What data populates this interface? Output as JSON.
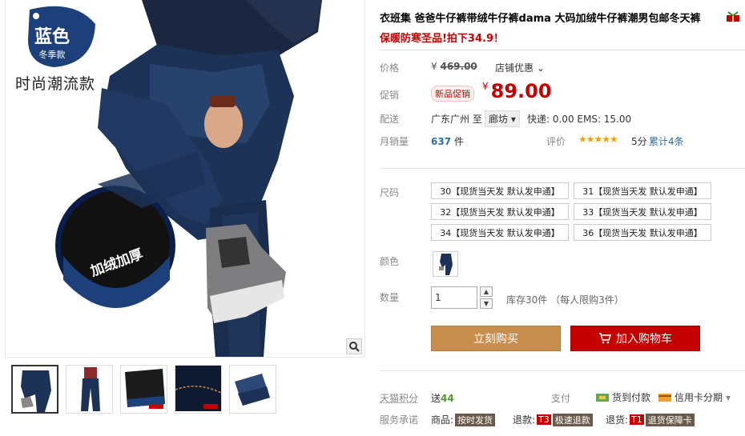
{
  "gallery": {
    "badge_main": "蓝色",
    "badge_sub": "冬季款",
    "slogan": "时尚潮流款",
    "lens_label": "加绒加厚",
    "thumbnails": [
      "thumb-1",
      "thumb-2",
      "thumb-3",
      "thumb-4",
      "thumb-5"
    ]
  },
  "product": {
    "title": "衣班集 爸爸牛仔裤带绒牛仔裤dama 大码加绒牛仔裤潮男包邮冬天裤",
    "promo_line": "保暖防寒圣品!拍下34.9！"
  },
  "price": {
    "label": "价格",
    "currency": "¥",
    "original": "469.00",
    "store_discount": "店铺优惠"
  },
  "promo": {
    "label": "促销",
    "tag": "新品促销",
    "currency": "¥",
    "price": "89.00"
  },
  "shipping": {
    "label": "配送",
    "from": "广东广州",
    "to_word": "至",
    "to": "廊坊",
    "fee": "快递: 0.00 EMS: 15.00"
  },
  "sales": {
    "label": "月销量",
    "count": "637",
    "unit": "件",
    "rating_label": "评价",
    "stars": "★★★★★",
    "score": "5分",
    "reviews": "累计4条"
  },
  "size": {
    "label": "尺码",
    "options": [
      "30【现货当天发 默认发申通】",
      "31【现货当天发 默认发申通】",
      "32【现货当天发 默认发申通】",
      "33【现货当天发 默认发申通】",
      "34【现货当天发 默认发申通】",
      "36【现货当天发 默认发申通】"
    ]
  },
  "color": {
    "label": "颜色"
  },
  "quantity": {
    "label": "数量",
    "value": "1",
    "stock": "库存30件 （每人限购3件）"
  },
  "actions": {
    "buy_now": "立刻购买",
    "add_cart": "加入购物车"
  },
  "points": {
    "label": "天猫积分",
    "prefix": "送",
    "value": "44"
  },
  "payment": {
    "label": "支付",
    "cod": "货到付款",
    "card": "信用卡分期"
  },
  "service": {
    "label": "服务承诺",
    "goods_label": "商品:",
    "goods_tag": "按时发货",
    "refund_label": "退款:",
    "refund_code": "T3",
    "refund_tag": "极速退款",
    "return_label": "退货:",
    "return_code": "T1",
    "return_tag": "退货保障卡"
  },
  "colors": {
    "accent_red": "#c40000",
    "buy_now_bg": "#c88e4e",
    "badge_blue": "#1d3f7a"
  }
}
